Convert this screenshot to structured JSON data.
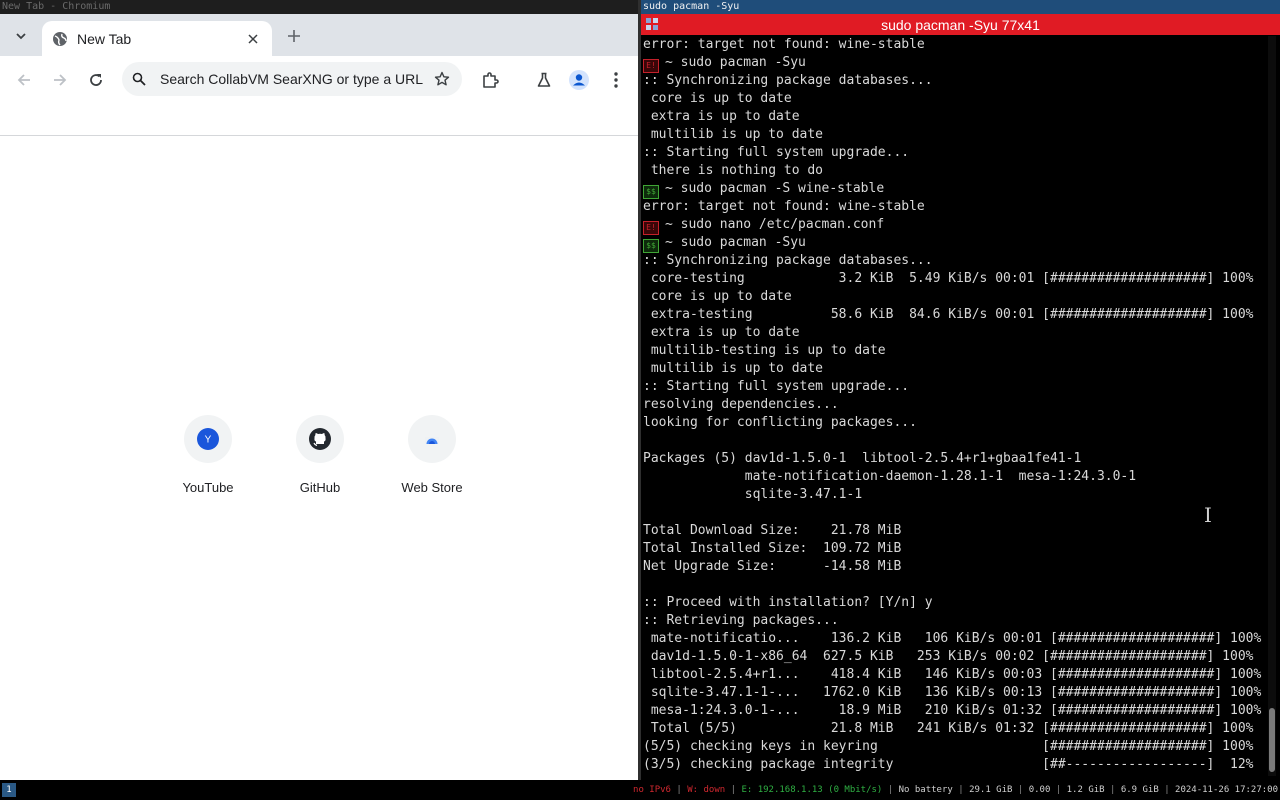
{
  "chromium": {
    "window_title": "New Tab - Chromium",
    "tab": {
      "title": "New Tab"
    },
    "omnibox": {
      "placeholder": "Search CollabVM SearXNG or type a URL"
    },
    "shortcuts": [
      {
        "label": "YouTube",
        "tile_letter": "Y"
      },
      {
        "label": "GitHub"
      },
      {
        "label": "Web Store"
      }
    ]
  },
  "terminal": {
    "window_title": "sudo pacman -Syu",
    "title_bar": "sudo pacman -Syu 77x41",
    "prompt_marks": {
      "error": "E!",
      "ok": "$$"
    },
    "lines": [
      {
        "text": "error: target not found: wine-stable"
      },
      {
        "prompt": "error",
        "text": "~ sudo pacman -Syu"
      },
      {
        "text": ":: Synchronizing package databases..."
      },
      {
        "text": " core is up to date"
      },
      {
        "text": " extra is up to date"
      },
      {
        "text": " multilib is up to date"
      },
      {
        "text": ":: Starting full system upgrade..."
      },
      {
        "text": " there is nothing to do"
      },
      {
        "prompt": "ok",
        "text": "~ sudo pacman -S wine-stable"
      },
      {
        "text": "error: target not found: wine-stable"
      },
      {
        "prompt": "error",
        "text": "~ sudo nano /etc/pacman.conf"
      },
      {
        "prompt": "ok",
        "text": "~ sudo pacman -Syu"
      },
      {
        "text": ":: Synchronizing package databases..."
      },
      {
        "text": " core-testing            3.2 KiB  5.49 KiB/s 00:01 [####################] 100%"
      },
      {
        "text": " core is up to date"
      },
      {
        "text": " extra-testing          58.6 KiB  84.6 KiB/s 00:01 [####################] 100%"
      },
      {
        "text": " extra is up to date"
      },
      {
        "text": " multilib-testing is up to date"
      },
      {
        "text": " multilib is up to date"
      },
      {
        "text": ":: Starting full system upgrade..."
      },
      {
        "text": "resolving dependencies..."
      },
      {
        "text": "looking for conflicting packages..."
      },
      {
        "text": ""
      },
      {
        "text": "Packages (5) dav1d-1.5.0-1  libtool-2.5.4+r1+gbaa1fe41-1"
      },
      {
        "text": "             mate-notification-daemon-1.28.1-1  mesa-1:24.3.0-1"
      },
      {
        "text": "             sqlite-3.47.1-1"
      },
      {
        "text": ""
      },
      {
        "text": "Total Download Size:    21.78 MiB"
      },
      {
        "text": "Total Installed Size:  109.72 MiB"
      },
      {
        "text": "Net Upgrade Size:      -14.58 MiB"
      },
      {
        "text": ""
      },
      {
        "text": ":: Proceed with installation? [Y/n] y"
      },
      {
        "text": ":: Retrieving packages..."
      },
      {
        "text": " mate-notificatio...    136.2 KiB   106 KiB/s 00:01 [####################] 100%"
      },
      {
        "text": " dav1d-1.5.0-1-x86_64  627.5 KiB   253 KiB/s 00:02 [####################] 100%"
      },
      {
        "text": " libtool-2.5.4+r1...    418.4 KiB   146 KiB/s 00:03 [####################] 100%"
      },
      {
        "text": " sqlite-3.47.1-1-...   1762.0 KiB   136 KiB/s 00:13 [####################] 100%"
      },
      {
        "text": " mesa-1:24.3.0-1-...     18.9 MiB   210 KiB/s 01:32 [####################] 100%"
      },
      {
        "text": " Total (5/5)            21.8 MiB   241 KiB/s 01:32 [####################] 100%"
      },
      {
        "text": "(5/5) checking keys in keyring                     [####################] 100%"
      },
      {
        "text": "(3/5) checking package integrity                   [##------------------]  12%"
      }
    ]
  },
  "statusbar": {
    "workspace": "1",
    "ipv6": "no IPv6",
    "wireless": "W: down",
    "ethernet": "E: 192.168.1.13 (0 Mbit/s)",
    "battery": "No battery",
    "disk": "29.1 GiB",
    "load": "0.00",
    "memory_used": "1.2 GiB",
    "memory_free": "6.9 GiB",
    "datetime": "2024-11-26 17:27:00"
  },
  "colors": {
    "chromium_accent": "#1a73e8",
    "terminal_title_bg": "#e01b24",
    "prompt_error": "#c4202a",
    "prompt_ok": "#3fa535",
    "status_down": "#d0282f",
    "status_up": "#2fb043"
  }
}
